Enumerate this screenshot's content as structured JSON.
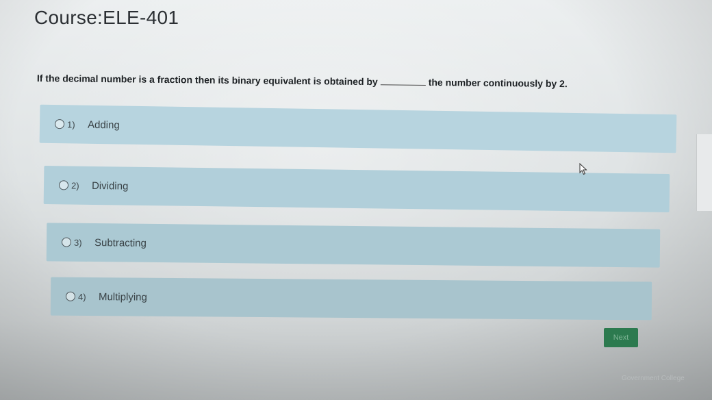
{
  "course": {
    "title": "Course:ELE-401"
  },
  "question": {
    "text_before": "If the decimal number is a fraction then its binary equivalent is obtained by",
    "text_after": "the number continuously by 2."
  },
  "options": [
    {
      "number": "1)",
      "label": "Adding"
    },
    {
      "number": "2)",
      "label": "Dividing"
    },
    {
      "number": "3)",
      "label": "Subtracting"
    },
    {
      "number": "4)",
      "label": "Multiplying"
    }
  ],
  "actions": {
    "next_label": "Next"
  },
  "footer": {
    "text": "Government College"
  },
  "colors": {
    "option_background": "#b7d4df",
    "next_button": "#2c7a4f"
  }
}
